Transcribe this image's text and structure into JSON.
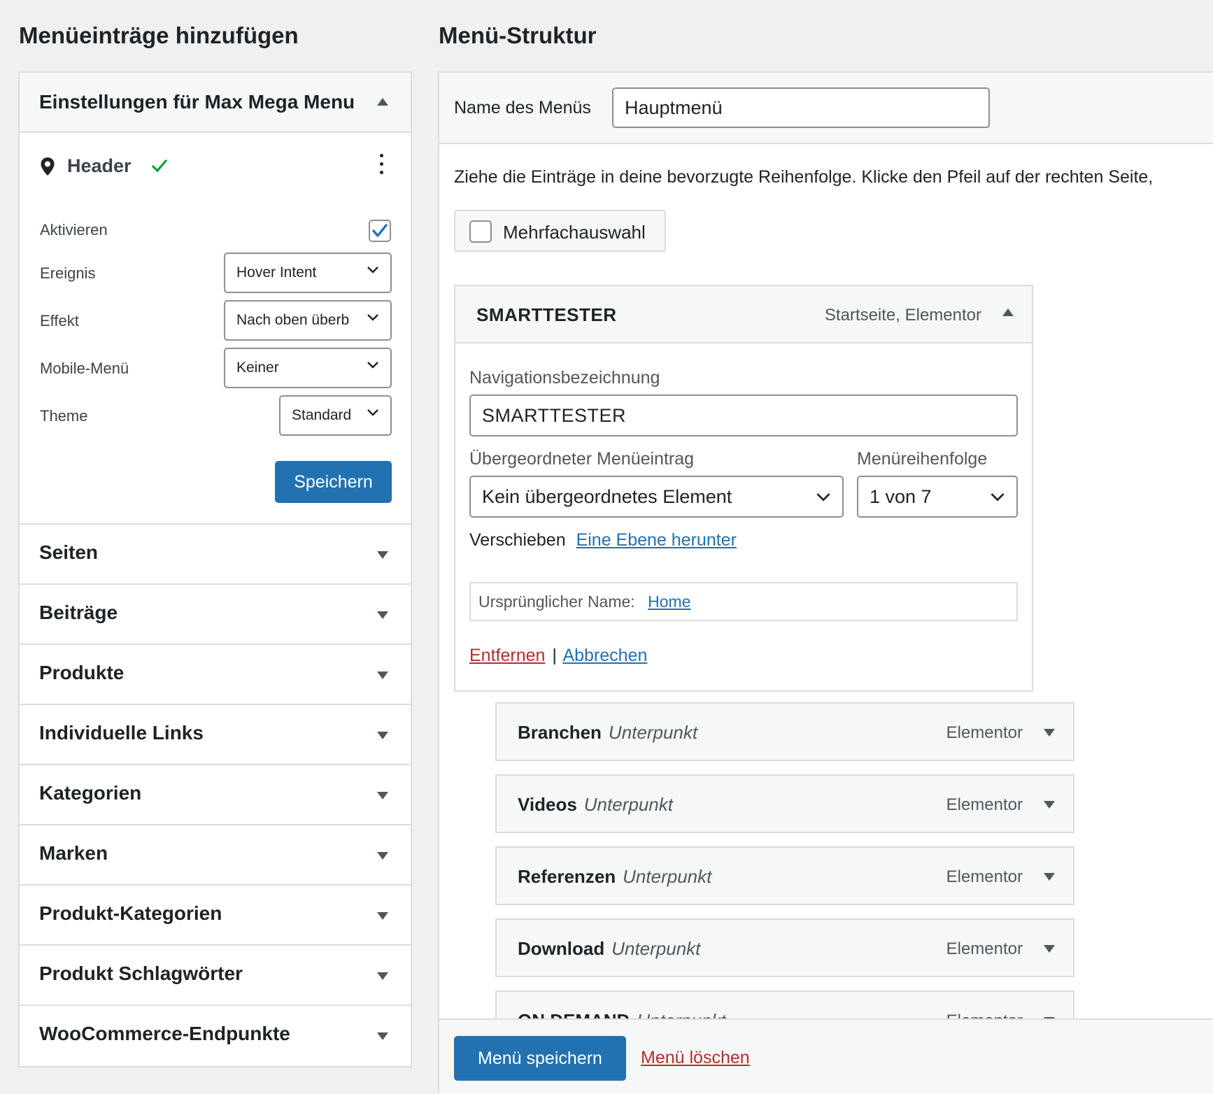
{
  "left": {
    "heading": "Menüeinträge hinzufügen",
    "settings": {
      "title": "Einstellungen für Max Mega Menu",
      "location": "Header",
      "activate_label": "Aktivieren",
      "activate_checked": true,
      "event_label": "Ereignis",
      "event_value": "Hover Intent",
      "effect_label": "Effekt",
      "effect_value": "Nach oben überb",
      "mobile_label": "Mobile-Menü",
      "mobile_value": "Keiner",
      "theme_label": "Theme",
      "theme_value": "Standard",
      "save_label": "Speichern"
    },
    "sections": [
      "Seiten",
      "Beiträge",
      "Produkte",
      "Individuelle Links",
      "Kategorien",
      "Marken",
      "Produkt-Kategorien",
      "Produkt Schlagwörter",
      "WooCommerce-Endpunkte"
    ]
  },
  "right": {
    "heading": "Menü-Struktur",
    "menu_name_label": "Name des Menüs",
    "menu_name_value": "Hauptmenü",
    "instructions": "Ziehe die Einträge in deine bevorzugte Reihenfolge. Klicke den Pfeil auf der rechten Seite,",
    "multi_select_label": "Mehrfachauswahl",
    "expanded_item": {
      "title": "SMARTTESTER",
      "type": "Startseite, Elementor",
      "nav_label_label": "Navigationsbezeichnung",
      "nav_label_value": "SMARTTESTER",
      "parent_label": "Übergeordneter Menüeintrag",
      "parent_value": "Kein übergeordnetes Element",
      "order_label": "Menüreihenfolge",
      "order_value": "1 von 7",
      "move_label": "Verschieben",
      "move_link": "Eine Ebene herunter",
      "original_label": "Ursprünglicher Name:",
      "original_link": "Home",
      "remove_label": "Entfernen",
      "separator": "|",
      "cancel_label": "Abbrechen"
    },
    "items": [
      {
        "title": "Branchen",
        "sub": "Unterpunkt",
        "type": "Elementor"
      },
      {
        "title": "Videos",
        "sub": "Unterpunkt",
        "type": "Elementor"
      },
      {
        "title": "Referenzen",
        "sub": "Unterpunkt",
        "type": "Elementor"
      },
      {
        "title": "Download",
        "sub": "Unterpunkt",
        "type": "Elementor"
      },
      {
        "title": "ON DEMAND",
        "sub": "Unterpunkt",
        "type": "Elementor"
      }
    ],
    "save_menu_label": "Menü speichern",
    "delete_menu_label": "Menü löschen"
  },
  "colors": {
    "primary": "#2271b1",
    "danger": "#b32d2e",
    "success": "#00a32a",
    "background": "#f0f0f1",
    "border": "#dcdcde"
  },
  "icons": [
    "location-pin-icon",
    "checkmark-icon",
    "kebab-menu-icon",
    "chevron-down-icon",
    "triangle-up-icon",
    "triangle-down-icon",
    "checkbox-icon"
  ]
}
